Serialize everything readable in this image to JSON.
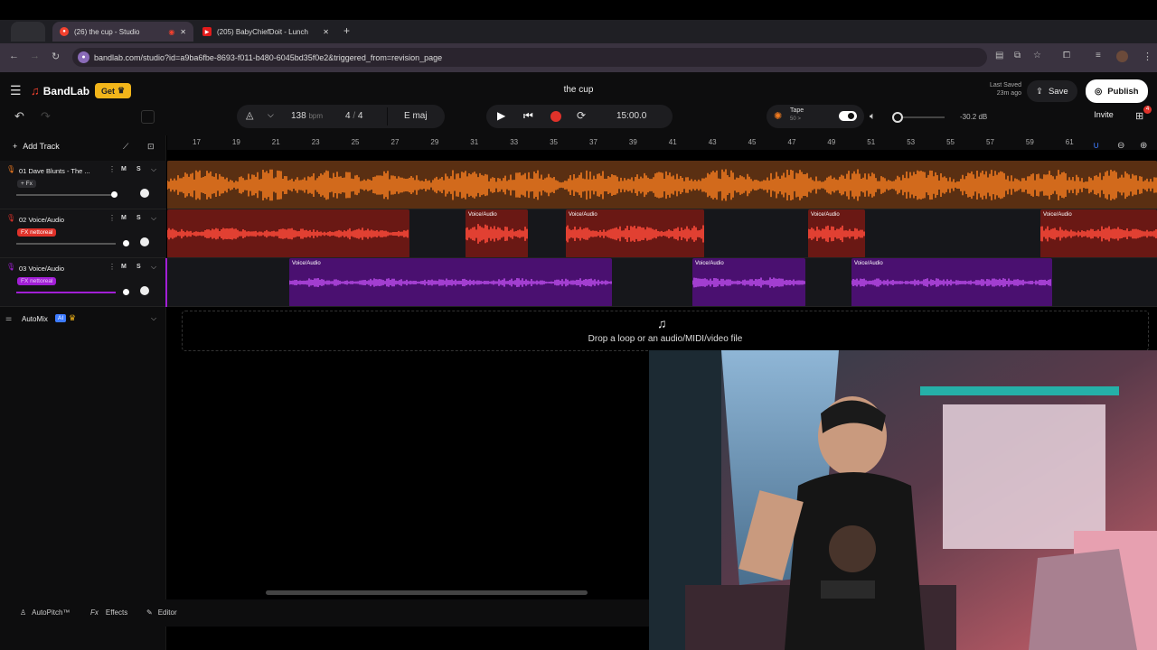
{
  "browser": {
    "tabs": [
      {
        "label": "(26) the cup - Studio",
        "active": true
      },
      {
        "label": "(205) BabyChiefDoit - Lunch",
        "active": false
      }
    ],
    "new_tab": "+",
    "url": "bandlab.com/studio?id=a9ba6fbe-8693-f011-b480-6045bd35f0e2&triggered_from=revision_page"
  },
  "app": {
    "brand": "BandLab",
    "get_label": "Get",
    "project_title": "the cup",
    "last_saved_line1": "Last Saved",
    "last_saved_line2": "23m ago",
    "save_label": "Save",
    "publish_label": "Publish",
    "invite_label": "Invite",
    "notification_count": "4"
  },
  "transport": {
    "tempo": "138",
    "tempo_unit": "bpm",
    "time_sig_num": "4",
    "time_sig_sep": "/",
    "time_sig_den": "4",
    "key": "E maj",
    "time": "15:00.0",
    "tape_label": "Tape",
    "tape_sub": "50 >",
    "volume_db": "-30.2 dB"
  },
  "sidebar": {
    "add_track": "Add Track",
    "tracks": [
      {
        "num": "01",
        "name": "Dave Blunts - The ...",
        "badge": "+ Fx",
        "mute": "M",
        "solo": "S",
        "color": "#f07a1f"
      },
      {
        "num": "02",
        "name": "Voice/Audio",
        "badge": "FX nettoreal",
        "mute": "M",
        "solo": "S",
        "color": "#e0322a"
      },
      {
        "num": "03",
        "name": "Voice/Audio",
        "badge": "FX nettoreal",
        "mute": "M",
        "solo": "S",
        "color": "#a21fd6"
      }
    ],
    "automix_label": "AutoMix",
    "ai_badge": "AI"
  },
  "ruler": {
    "bars": [
      "17",
      "19",
      "21",
      "23",
      "25",
      "27",
      "29",
      "31",
      "33",
      "35",
      "37",
      "39",
      "41",
      "43",
      "45",
      "47",
      "49",
      "51",
      "53",
      "55",
      "57",
      "59",
      "61"
    ]
  },
  "clips": {
    "clip_label": "Voice/Audio"
  },
  "drop_zone": {
    "text": "Drop a loop or an audio/MIDI/video file"
  },
  "bottom": {
    "autopitch": "AutoPitch™",
    "fx_prefix": "Fx",
    "effects": "Effects",
    "editor": "Editor"
  },
  "colors": {
    "orange": "#f07a1f",
    "red": "#e0322a",
    "purple": "#a21fd6",
    "brand_red": "#f2412e",
    "gold": "#f2b51a"
  }
}
